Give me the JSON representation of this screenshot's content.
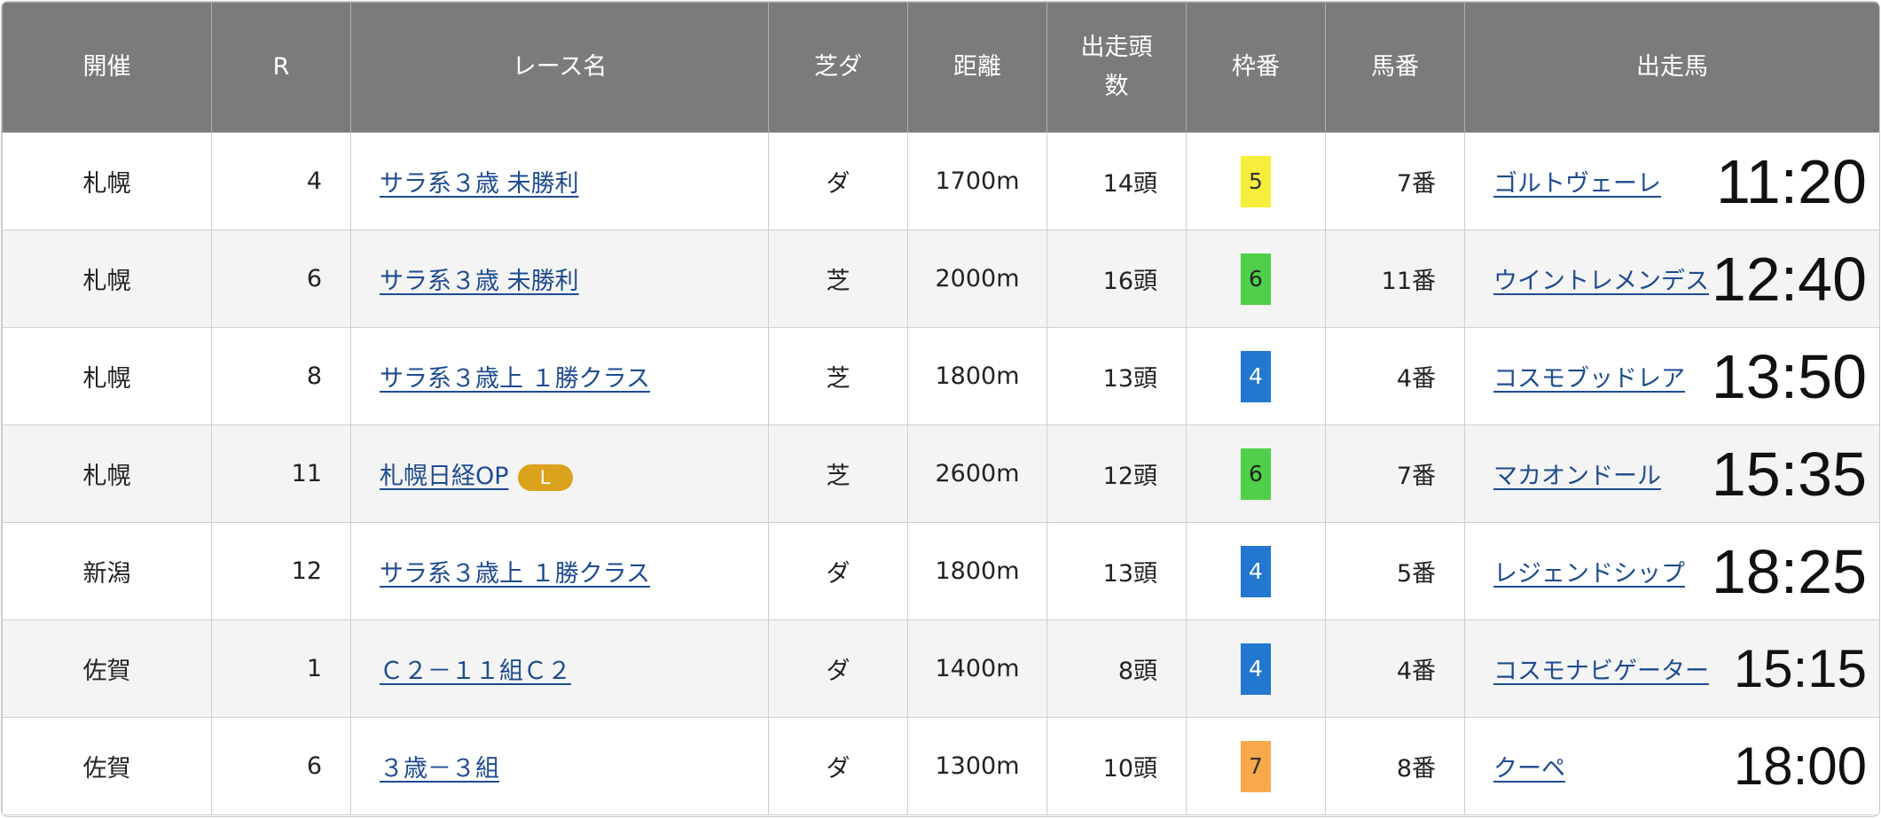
{
  "headers": [
    "開催",
    "R",
    "レース名",
    "芝ダ",
    "距離",
    "出走頭",
    "数",
    "枠番",
    "馬番",
    "出走馬"
  ],
  "rows": [
    {
      "venue": "札幌",
      "r": "4",
      "race": "サラ系３歳 未勝利",
      "badge": "",
      "surface": "ダ",
      "distance": "1700m",
      "runners": "14頭",
      "waku": "5",
      "waku_bg": "#f7ed3b",
      "waku_fg": "#333333",
      "umaban": "7番",
      "horse": "ゴルトヴェーレ",
      "time": "11:20"
    },
    {
      "venue": "札幌",
      "r": "6",
      "race": "サラ系３歳 未勝利",
      "badge": "",
      "surface": "芝",
      "distance": "2000m",
      "runners": "16頭",
      "waku": "6",
      "waku_bg": "#4fcf4a",
      "waku_fg": "#222222",
      "umaban": "11番",
      "horse": "ウイントレメンデス",
      "time": "12:40"
    },
    {
      "venue": "札幌",
      "r": "8",
      "race": "サラ系３歳上 １勝クラス",
      "badge": "",
      "surface": "芝",
      "distance": "1800m",
      "runners": "13頭",
      "waku": "4",
      "waku_bg": "#2277cf",
      "waku_fg": "#ffffff",
      "umaban": "4番",
      "horse": "コスモブッドレア",
      "time": "13:50"
    },
    {
      "venue": "札幌",
      "r": "11",
      "race": "札幌日経OP",
      "badge": "L",
      "surface": "芝",
      "distance": "2600m",
      "runners": "12頭",
      "waku": "6",
      "waku_bg": "#4fcf4a",
      "waku_fg": "#222222",
      "umaban": "7番",
      "horse": "マカオンドール",
      "time": "15:35"
    },
    {
      "venue": "新潟",
      "r": "12",
      "race": "サラ系３歳上 １勝クラス",
      "badge": "",
      "surface": "ダ",
      "distance": "1800m",
      "runners": "13頭",
      "waku": "4",
      "waku_bg": "#2277cf",
      "waku_fg": "#ffffff",
      "umaban": "5番",
      "horse": "レジェンドシップ",
      "time": "18:25"
    },
    {
      "venue": "佐賀",
      "r": "1",
      "race": "Ｃ２－１１組Ｃ２",
      "badge": "",
      "surface": "ダ",
      "distance": "1400m",
      "runners": "8頭",
      "waku": "4",
      "waku_bg": "#2277cf",
      "waku_fg": "#ffffff",
      "umaban": "4番",
      "horse": "コスモナビゲーター",
      "time": "15:15"
    },
    {
      "venue": "佐賀",
      "r": "6",
      "race": "３歳－３組",
      "badge": "",
      "surface": "ダ",
      "distance": "1300m",
      "runners": "10頭",
      "waku": "7",
      "waku_bg": "#f8a94c",
      "waku_fg": "#333333",
      "umaban": "8番",
      "horse": "クーペ",
      "time": "18:00"
    }
  ]
}
